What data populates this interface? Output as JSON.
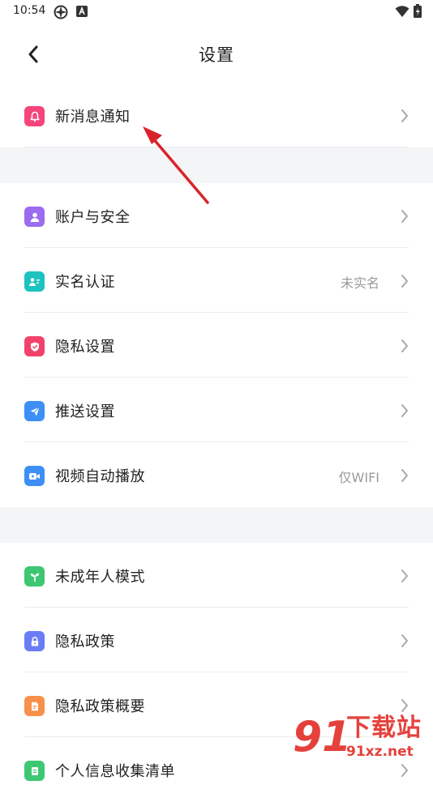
{
  "status_bar": {
    "time": "10:54"
  },
  "header": {
    "title": "设置"
  },
  "groups": [
    {
      "items": [
        {
          "label": "新消息通知",
          "value": "",
          "icon": "bell-icon",
          "color": "#f5457a"
        }
      ]
    },
    {
      "items": [
        {
          "label": "账户与安全",
          "value": "",
          "icon": "user-icon",
          "color": "#9b6cf0"
        },
        {
          "label": "实名认证",
          "value": "未实名",
          "icon": "id-card-icon",
          "color": "#1cc3bf"
        },
        {
          "label": "隐私设置",
          "value": "",
          "icon": "shield-icon",
          "color": "#f3426a"
        },
        {
          "label": "推送设置",
          "value": "",
          "icon": "send-icon",
          "color": "#3d8ff5"
        },
        {
          "label": "视频自动播放",
          "value": "仅WIFI",
          "icon": "video-icon",
          "color": "#3d8ff5"
        }
      ]
    },
    {
      "items": [
        {
          "label": "未成年人模式",
          "value": "",
          "icon": "sprout-icon",
          "color": "#3ec772"
        },
        {
          "label": "隐私政策",
          "value": "",
          "icon": "lock-icon",
          "color": "#6b7cf5"
        },
        {
          "label": "隐私政策概要",
          "value": "",
          "icon": "document-icon",
          "color": "#f7904a"
        },
        {
          "label": "个人信息收集清单",
          "value": "",
          "icon": "list-icon",
          "color": "#3ec772"
        }
      ]
    }
  ],
  "watermark": {
    "logo": "91",
    "title": "下载站",
    "url": "91xz.net"
  },
  "colors": {
    "background": "#ffffff",
    "group_gap": "#f4f5f7",
    "annotation_arrow": "#d9232a"
  }
}
